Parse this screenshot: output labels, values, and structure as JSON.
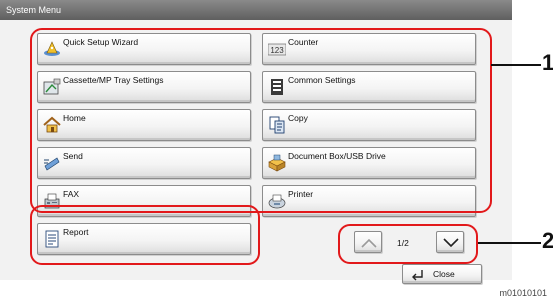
{
  "window": {
    "title": "System Menu"
  },
  "menu": {
    "left": [
      {
        "label": "Quick Setup Wizard",
        "icon": "wizard-hat-icon"
      },
      {
        "label": "Cassette/MP Tray Settings",
        "icon": "tray-settings-icon"
      },
      {
        "label": "Home",
        "icon": "home-icon"
      },
      {
        "label": "Send",
        "icon": "send-icon"
      },
      {
        "label": "FAX",
        "icon": "fax-icon"
      },
      {
        "label": "Report",
        "icon": "report-icon"
      }
    ],
    "right": [
      {
        "label": "Counter",
        "icon": "counter-icon",
        "icon_text": "123"
      },
      {
        "label": "Common Settings",
        "icon": "common-settings-icon"
      },
      {
        "label": "Copy",
        "icon": "copy-icon"
      },
      {
        "label": "Document Box/USB Drive",
        "icon": "document-box-icon"
      },
      {
        "label": "Printer",
        "icon": "printer-icon"
      }
    ]
  },
  "pager": {
    "indicator": "1/2",
    "up_icon": "chevron-up-icon",
    "down_icon": "chevron-down-icon"
  },
  "close": {
    "label": "Close",
    "icon": "return-arrow-icon"
  },
  "callouts": {
    "one": "1",
    "two": "2"
  },
  "reference_code": "m01010101",
  "colors": {
    "callout_outline": "#e2191b",
    "titlebar": "#6e6e6e"
  }
}
